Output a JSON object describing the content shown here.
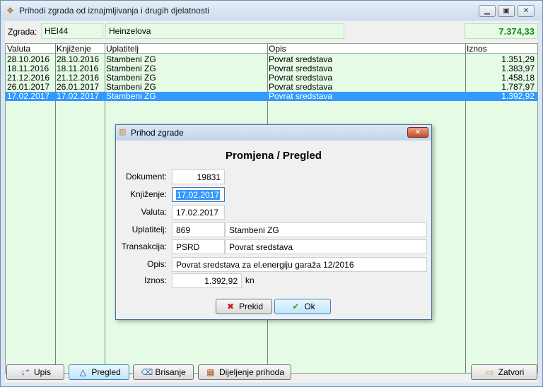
{
  "window": {
    "title": "Prihodi zgrada od iznajmljivanja i drugih djelatnosti",
    "icon": "building-money-icon"
  },
  "zgrada": {
    "label": "Zgrada:",
    "code": "HEI44",
    "name": "Heinzelova",
    "total": "7.374,33"
  },
  "grid": {
    "columns": [
      "Valuta",
      "Knjiženje",
      "Uplatitelj",
      "Opis",
      "Iznos"
    ],
    "rows": [
      {
        "valuta": "28.10.2016",
        "knjizenje": "28.10.2016",
        "uplatitelj": "Stambeni ZG",
        "opis": "Povrat sredstava",
        "iznos": "1.351,29",
        "selected": false
      },
      {
        "valuta": "18.11.2016",
        "knjizenje": "18.11.2016",
        "uplatitelj": "Stambeni ZG",
        "opis": "Povrat sredstava",
        "iznos": "1.383,97",
        "selected": false
      },
      {
        "valuta": "21.12.2016",
        "knjizenje": "21.12.2016",
        "uplatitelj": "Stambeni ZG",
        "opis": "Povrat sredstava",
        "iznos": "1.458,18",
        "selected": false
      },
      {
        "valuta": "26.01.2017",
        "knjizenje": "26.01.2017",
        "uplatitelj": "Stambeni ZG",
        "opis": "Povrat sredstava",
        "iznos": "1.787,97",
        "selected": false
      },
      {
        "valuta": "17.02.2017",
        "knjizenje": "17.02.2017",
        "uplatitelj": "Stambeni ZG",
        "opis": "Povrat sredstava",
        "iznos": "1.392,92",
        "selected": true
      }
    ],
    "nav": [
      "|◀",
      "◀◀",
      "◀",
      "?",
      "▶",
      "▶▶",
      "▶|"
    ]
  },
  "toolbar": {
    "upis": "Upis",
    "pregled": "Pregled",
    "brisanje": "Brisanje",
    "dijeljenje": "Dijeljenje prihoda",
    "zatvori": "Zatvori"
  },
  "dialog": {
    "title": "Prihod zgrade",
    "heading": "Promjena / Pregled",
    "dokument_label": "Dokument:",
    "dokument": "19831",
    "knjizenje_label": "Knjiženje:",
    "knjizenje": "17.02.2017",
    "valuta_label": "Valuta:",
    "valuta": "17.02.2017",
    "uplatitelj_label": "Uplatitelj:",
    "uplatitelj_code": "869",
    "uplatitelj_name": "Stambeni ZG",
    "transakcija_label": "Transakcija:",
    "transakcija_code": "PSRD",
    "transakcija_name": "Povrat sredstava",
    "opis_label": "Opis:",
    "opis": "Povrat sredstava za el.energiju garaža 12/2016",
    "iznos_label": "Iznos:",
    "iznos": "1.392,92",
    "iznos_unit": "kn",
    "prekid": "Prekid",
    "ok": "Ok"
  }
}
